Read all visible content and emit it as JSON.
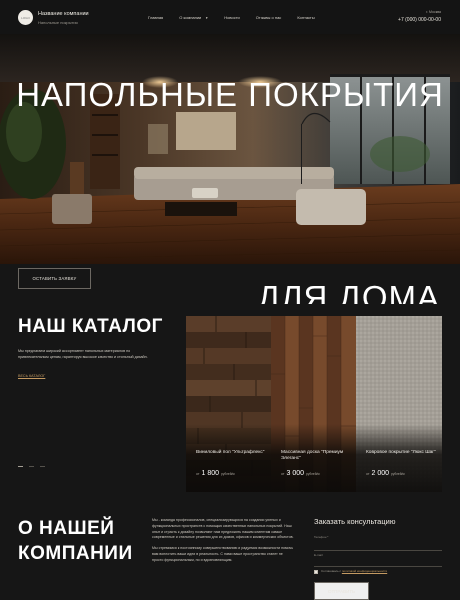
{
  "header": {
    "logo_text": "LOGO",
    "company_name": "Название компании",
    "company_sub": "Напольные покрытия",
    "nav": [
      {
        "label": "Главная",
        "has_dropdown": false
      },
      {
        "label": "О компании",
        "has_dropdown": true
      },
      {
        "label": "Новости",
        "has_dropdown": false
      },
      {
        "label": "Отзывы о нас",
        "has_dropdown": false
      },
      {
        "label": "Контакты",
        "has_dropdown": false
      }
    ],
    "city": "г. Москва",
    "phone": "+7 (000) 000-00-00"
  },
  "hero": {
    "title_top": "НАПОЛЬНЫЕ ПОКРЫТИЯ",
    "title_bottom": "ДЛЯ ДОМА",
    "cta_label": "ОСТАВИТЬ ЗАЯВКУ"
  },
  "catalog": {
    "title": "НАШ КАТАЛОГ",
    "description": "Мы предлагаем широкий ассортимент напольных материалов по привлекательным ценам, гарантируя высокое качество и стильный дизайн.",
    "link_label": "ВЕСЬ КАТАЛОГ",
    "products": [
      {
        "name": "Виниловый пол \"Ультрафлекс\"",
        "from": "от",
        "price": "1 800",
        "unit": "рублей/м"
      },
      {
        "name": "Массивная доска \"Премиум Элеганс\"",
        "from": "от",
        "price": "3 000",
        "unit": "рублей/м"
      },
      {
        "name": "Ковровое покрытие \"Люкс Шаг\"",
        "from": "от",
        "price": "2 000",
        "unit": "рублей/м"
      }
    ]
  },
  "about": {
    "title_line1": "О НАШЕЙ",
    "title_line2": "КОМПАНИИ",
    "paragraph1": "Мы - команда профессионалов, специализирующихся на создании уютных и функциональных пространств с помощью качественных напольных покрытий. Наш опыт и страсть к дизайну позволяют нам предложить нашим клиентам самые современные и стильные решения для их домов, офисов и коммерческих объектов.",
    "paragraph2": "Мы стремимся к постоянному совершенствованию и радуемся возможности помочь вам воплотить ваши идеи в реальность. С нами ваше пространство станет не просто функциональным, но и вдохновляющим."
  },
  "form": {
    "title": "Заказать консультацию",
    "name_label": "Телефон *",
    "email_label": "E-mail",
    "consent_prefix": "Соглашаюсь с ",
    "consent_link": "политикой конфиденциальности",
    "submit_label": "ОТПРАВИТЬ"
  },
  "colors": {
    "background": "#161616",
    "accent": "#c49a62"
  }
}
